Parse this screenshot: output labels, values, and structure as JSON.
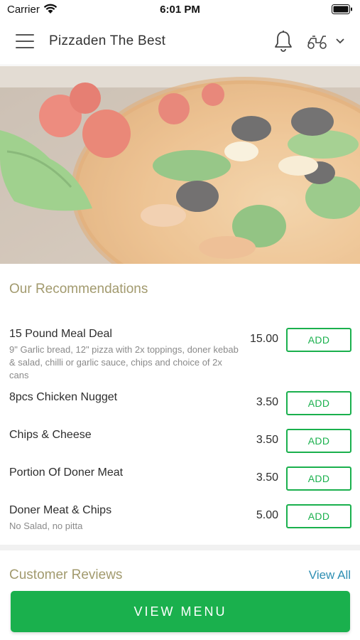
{
  "status_bar": {
    "carrier": "Carrier",
    "time": "6:01 PM"
  },
  "header": {
    "title": "Pizzaden The Best"
  },
  "recommendations": {
    "title": "Our Recommendations",
    "items": [
      {
        "name": "15 Pound Meal Deal",
        "description": "9\" Garlic bread, 12\" pizza with 2x toppings, doner kebab & salad, chilli or garlic sauce, chips and choice of 2x cans",
        "price": "15.00",
        "button": "ADD"
      },
      {
        "name": "8pcs Chicken Nugget",
        "description": "",
        "price": "3.50",
        "button": "ADD"
      },
      {
        "name": "Chips & Cheese",
        "description": "",
        "price": "3.50",
        "button": "ADD"
      },
      {
        "name": "Portion Of Doner Meat",
        "description": "",
        "price": "3.50",
        "button": "ADD"
      },
      {
        "name": "Doner Meat & Chips",
        "description": "No Salad, no pitta",
        "price": "5.00",
        "button": "ADD"
      }
    ]
  },
  "reviews": {
    "title": "Customer Reviews",
    "view_all": "View All"
  },
  "footer": {
    "view_menu": "VIEW MENU"
  },
  "colors": {
    "accent_green": "#1ab04d",
    "section_title": "#a29a6e",
    "link_blue": "#2f8fb3"
  }
}
